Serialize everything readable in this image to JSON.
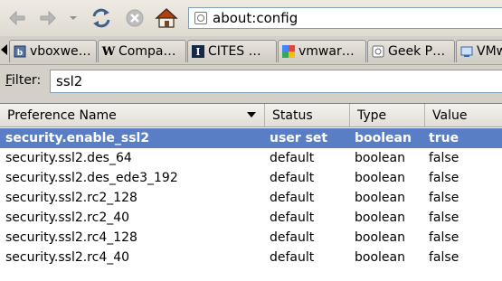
{
  "nav": {
    "url": "about:config"
  },
  "tabs": [
    {
      "label": "vboxwe…",
      "icon": "firefox-favicon-icon"
    },
    {
      "label": "Compa…",
      "icon": "wikipedia-favicon-icon"
    },
    {
      "label": "CITES …",
      "icon": "illinois-favicon-icon"
    },
    {
      "label": "vmwar…",
      "icon": "google-favicon-icon"
    },
    {
      "label": "Geek P…",
      "icon": "page-favicon-icon"
    },
    {
      "label": "VMw",
      "icon": "vm-favicon-icon"
    }
  ],
  "filter": {
    "label_accesskey": "F",
    "label_rest": "ilter:",
    "value": "ssl2"
  },
  "columns": {
    "name": "Preference Name",
    "status": "Status",
    "type": "Type",
    "value": "Value"
  },
  "rows": [
    {
      "name": "security.enable_ssl2",
      "status": "user set",
      "type": "boolean",
      "value": "true"
    },
    {
      "name": "security.ssl2.des_64",
      "status": "default",
      "type": "boolean",
      "value": "false"
    },
    {
      "name": "security.ssl2.des_ede3_192",
      "status": "default",
      "type": "boolean",
      "value": "false"
    },
    {
      "name": "security.ssl2.rc2_128",
      "status": "default",
      "type": "boolean",
      "value": "false"
    },
    {
      "name": "security.ssl2.rc2_40",
      "status": "default",
      "type": "boolean",
      "value": "false"
    },
    {
      "name": "security.ssl2.rc4_128",
      "status": "default",
      "type": "boolean",
      "value": "false"
    },
    {
      "name": "security.ssl2.rc4_40",
      "status": "default",
      "type": "boolean",
      "value": "false"
    }
  ],
  "colors": {
    "selection": "#5a7ec6",
    "home_roof": "#b04010"
  }
}
